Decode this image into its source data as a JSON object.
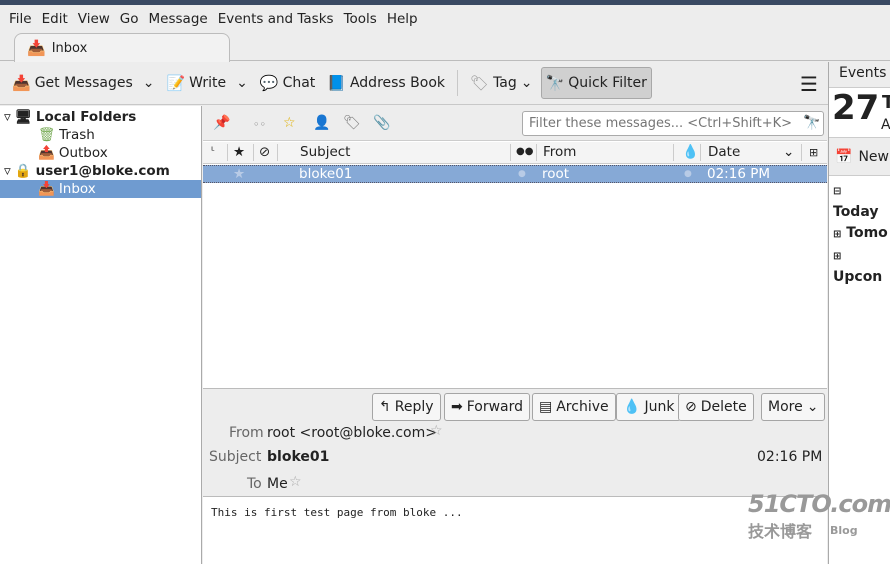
{
  "menu": [
    "File",
    "Edit",
    "View",
    "Go",
    "Message",
    "Events and Tasks",
    "Tools",
    "Help"
  ],
  "tab": {
    "label": "Inbox"
  },
  "toolbar": {
    "get_messages": "Get Messages",
    "write": "Write",
    "chat": "Chat",
    "address_book": "Address Book",
    "tag": "Tag",
    "quick_filter": "Quick Filter"
  },
  "folders": [
    {
      "label": "Local Folders",
      "level": 0,
      "bold": true,
      "icon": "computer-icon"
    },
    {
      "label": "Trash",
      "level": 1,
      "icon": "trash-icon"
    },
    {
      "label": "Outbox",
      "level": 1,
      "icon": "outbox-icon"
    },
    {
      "label": "user1@bloke.com",
      "level": 0,
      "bold": true,
      "icon": "account-icon"
    },
    {
      "label": "Inbox",
      "level": 1,
      "selected": true,
      "icon": "inbox-icon"
    }
  ],
  "filter": {
    "placeholder": "Filter these messages... <Ctrl+Shift+K>"
  },
  "columns": {
    "subject": "Subject",
    "from": "From",
    "date": "Date"
  },
  "messages": [
    {
      "subject": "bloke01",
      "from": "root",
      "date": "02:16 PM"
    }
  ],
  "actions": {
    "reply": "Reply",
    "forward": "Forward",
    "archive": "Archive",
    "junk": "Junk",
    "delete": "Delete",
    "more": "More"
  },
  "header": {
    "from_label": "From",
    "from": "root <root@bloke.com>",
    "subject_label": "Subject",
    "subject": "bloke01",
    "date": "02:16 PM",
    "to_label": "To",
    "to": "Me"
  },
  "body": "This is first test page from bloke ...",
  "events": {
    "title": "Events",
    "day": "27",
    "day_initial": "T",
    "month_initial": "A",
    "new": "New",
    "sections": [
      "Today",
      "Tomo",
      "Upcon"
    ]
  },
  "watermark": {
    "site": "51CTO.com",
    "sub": "技术博客",
    "blog": "Blog"
  }
}
